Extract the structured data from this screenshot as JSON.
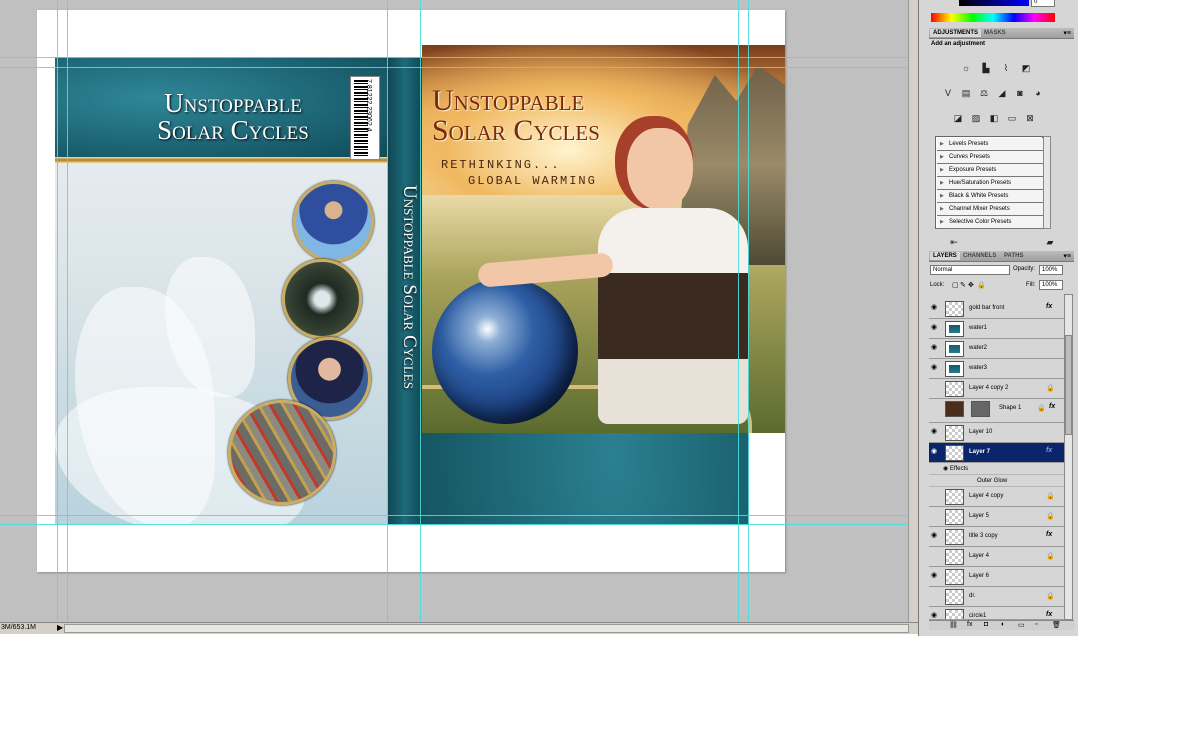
{
  "document": {
    "back_title": [
      "Unstoppable",
      "Solar Cycles"
    ],
    "front_title": [
      "Unstoppable",
      "Solar Cycles"
    ],
    "subtitle_line1": "RETHINKING...",
    "subtitle_line2": "GLOBAL WARMING",
    "spine_title": "Unstoppable Solar Cycles",
    "barcode_text": "7 81222 23062 4"
  },
  "statusbar": {
    "doc_size": "3M/653.1M"
  },
  "color_panel": {
    "value": "0"
  },
  "adjustments_panel": {
    "tabs": [
      "ADJUSTMENTS",
      "MASKS"
    ],
    "heading": "Add an adjustment",
    "presets": [
      "Levels Presets",
      "Curves Presets",
      "Exposure Presets",
      "Hue/Saturation Presets",
      "Black & White Presets",
      "Channel Mixer Presets",
      "Selective Color Presets"
    ]
  },
  "layers_panel": {
    "tabs": [
      "LAYERS",
      "CHANNELS",
      "PATHS"
    ],
    "blend_mode": "Normal",
    "opacity_label": "Opacity:",
    "opacity_value": "100%",
    "lock_label": "Lock:",
    "fill_label": "Fill:",
    "fill_value": "100%",
    "layers": [
      {
        "name": "gold bar front",
        "visible": true,
        "fx": true,
        "lock": false
      },
      {
        "name": "water1",
        "visible": true,
        "fx": false,
        "lock": false
      },
      {
        "name": "water2",
        "visible": true,
        "fx": false,
        "lock": false
      },
      {
        "name": "water3",
        "visible": true,
        "fx": false,
        "lock": false
      },
      {
        "name": "Layer 4 copy 2",
        "visible": false,
        "fx": false,
        "lock": true
      },
      {
        "name": "Shape 1",
        "visible": false,
        "fx": true,
        "lock": true
      },
      {
        "name": "Layer 10",
        "visible": true,
        "fx": false,
        "lock": false
      },
      {
        "name": "Layer 7",
        "visible": true,
        "fx": true,
        "lock": false,
        "active": true
      },
      {
        "name": "Layer 4 copy",
        "visible": false,
        "fx": false,
        "lock": true
      },
      {
        "name": "Layer 5",
        "visible": false,
        "fx": false,
        "lock": true
      },
      {
        "name": "title 3 copy",
        "visible": true,
        "fx": true,
        "lock": false
      },
      {
        "name": "Layer 4",
        "visible": false,
        "fx": false,
        "lock": true
      },
      {
        "name": "Layer 6",
        "visible": true,
        "fx": false,
        "lock": false
      },
      {
        "name": "dr.",
        "visible": false,
        "fx": false,
        "lock": true
      },
      {
        "name": "circle1",
        "visible": true,
        "fx": true,
        "lock": false
      }
    ],
    "effects_label": "Effects",
    "effect_name": "Outer Glow"
  }
}
